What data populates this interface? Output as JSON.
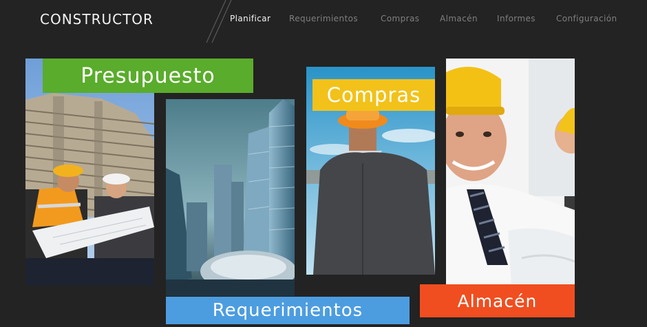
{
  "header": {
    "logo_text": "CONSTRUCTOR",
    "nav": [
      {
        "label": "Planificar",
        "active": true
      },
      {
        "label": "Requerimientos",
        "active": false
      },
      {
        "label": "Compras",
        "active": false
      },
      {
        "label": "Almacén",
        "active": false
      },
      {
        "label": "Informes",
        "active": false
      },
      {
        "label": "Configuración",
        "active": false
      }
    ]
  },
  "tiles": {
    "presupuesto": {
      "label": "Presupuesto",
      "color": "#5aac2c",
      "image": "construction-workers-photo"
    },
    "requerimientos": {
      "label": "Requerimientos",
      "color": "#4c9de0",
      "image": "city-skyscrapers-photo"
    },
    "compras": {
      "label": "Compras",
      "color": "#f2c21a",
      "image": "engineer-back-view-photo"
    },
    "almacen": {
      "label": "Almacén",
      "color": "#f04e20",
      "image": "smiling-workers-photo"
    }
  },
  "colors": {
    "background": "#232323",
    "nav_active": "#f4f4f4",
    "nav_inactive": "#7f7f7f"
  }
}
